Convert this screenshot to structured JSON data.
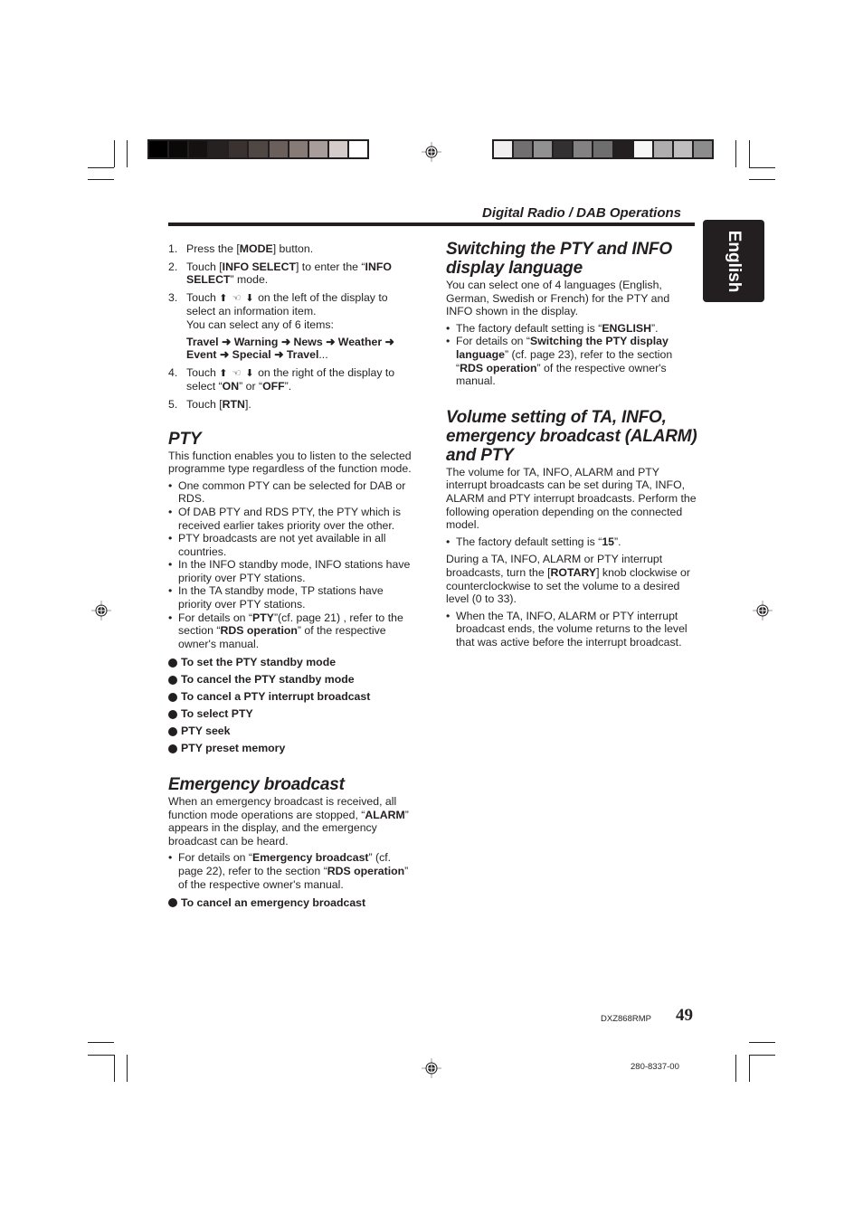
{
  "header": {
    "section_title": "Digital Radio / DAB Operations",
    "language_tab": "English"
  },
  "print_marks": {
    "left_color_bar": [
      "#000000",
      "#0b0908",
      "#151110",
      "#252120",
      "#3a3230",
      "#4f4744",
      "#6b5f5c",
      "#877b78",
      "#a89d9b",
      "#d4cccb",
      "#ffffff"
    ],
    "right_color_bar": [
      "#f0f0f0",
      "#707070",
      "#919191",
      "#323031",
      "#828282",
      "#6e6e6e",
      "#231f20",
      "#f7f7f7",
      "#aeaeae",
      "#bfbfbf",
      "#8c8c8c"
    ],
    "registration_icon": "crosshair-target-icon"
  },
  "left_column": {
    "steps": [
      {
        "num": "1.",
        "segments": [
          {
            "t": "Press the ["
          },
          {
            "t": "MODE",
            "b": true
          },
          {
            "t": "] button."
          }
        ]
      },
      {
        "num": "2.",
        "segments": [
          {
            "t": "Touch ["
          },
          {
            "t": "INFO SELECT",
            "b": true
          },
          {
            "t": "] to enter the “"
          },
          {
            "t": "INFO SELECT",
            "b": true
          },
          {
            "t": "” mode."
          }
        ]
      },
      {
        "num": "3.",
        "segments": [
          {
            "t": "Touch "
          },
          {
            "t": "⬆ ☜ ⬇",
            "g": true
          },
          {
            "t": " on the left of the display to select an information item."
          }
        ],
        "note": "You can select any of 6 items:",
        "sequence": [
          {
            "t": "Travel ➜ Warning ➜ News ➜ Weather ➜ Event ➜ Special ➜ Travel",
            "b": true
          },
          {
            "t": "..."
          }
        ]
      },
      {
        "num": "4.",
        "segments": [
          {
            "t": "Touch "
          },
          {
            "t": "⬆ ☜ ⬇",
            "g": true
          },
          {
            "t": " on the right of the display to select “"
          },
          {
            "t": "ON",
            "b": true
          },
          {
            "t": "” or “"
          },
          {
            "t": "OFF",
            "b": true
          },
          {
            "t": "”."
          }
        ]
      },
      {
        "num": "5.",
        "segments": [
          {
            "t": "Touch ["
          },
          {
            "t": "RTN",
            "b": true
          },
          {
            "t": "]."
          }
        ]
      }
    ],
    "pty": {
      "heading": "PTY",
      "intro": "This function enables you to listen to the selected programme type regardless of the function mode.",
      "bullets": [
        [
          {
            "t": "One common PTY can be selected for DAB or RDS."
          }
        ],
        [
          {
            "t": "Of DAB PTY and RDS PTY, the PTY which is received earlier takes priority over the other."
          }
        ],
        [
          {
            "t": "PTY broadcasts are not yet available in all countries."
          }
        ],
        [
          {
            "t": "In the INFO standby mode, INFO stations have priority over PTY stations."
          }
        ],
        [
          {
            "t": "In the TA standby mode, TP stations have priority over PTY stations."
          }
        ],
        [
          {
            "t": "For details on “"
          },
          {
            "t": "PTY",
            "b": true
          },
          {
            "t": "”(cf. page 21) , refer to the section “"
          },
          {
            "t": "RDS operation",
            "b": true
          },
          {
            "t": "” of the respective owner's manual."
          }
        ]
      ],
      "procedures": [
        "To set the PTY standby mode",
        "To cancel the PTY standby mode",
        "To cancel a PTY interrupt broadcast",
        "To select PTY",
        "PTY seek",
        "PTY preset memory"
      ]
    },
    "emergency": {
      "heading": "Emergency broadcast",
      "intro": [
        {
          "t": "When an emergency broadcast is received, all function mode operations are stopped, “"
        },
        {
          "t": "ALARM",
          "b": true
        },
        {
          "t": "” appears in the display, and the emergency broadcast can be heard."
        }
      ],
      "bullets": [
        [
          {
            "t": "For details on “"
          },
          {
            "t": "Emergency broadcast",
            "b": true
          },
          {
            "t": "” (cf. page 22), refer to the section “"
          },
          {
            "t": "RDS operation",
            "b": true
          },
          {
            "t": "” of the respective owner's manual."
          }
        ]
      ],
      "procedures": [
        "To cancel an emergency broadcast"
      ]
    }
  },
  "right_column": {
    "language": {
      "heading": "Switching the PTY and INFO display language",
      "intro": "You can select one of 4 languages (English, German, Swedish or French) for the PTY and INFO shown in the display.",
      "bullets": [
        [
          {
            "t": "The factory default setting is “"
          },
          {
            "t": "ENGLISH",
            "b": true
          },
          {
            "t": "”."
          }
        ],
        [
          {
            "t": "For details on “"
          },
          {
            "t": "Switching the PTY display language",
            "b": true
          },
          {
            "t": "” (cf. page 23), refer to the section “"
          },
          {
            "t": "RDS operation",
            "b": true
          },
          {
            "t": "” of the respective owner's manual."
          }
        ]
      ]
    },
    "volume": {
      "heading": "Volume setting of TA, INFO, emergency broadcast (ALARM) and PTY",
      "intro": "The volume for TA, INFO, ALARM and PTY interrupt broadcasts can be set during TA, INFO, ALARM and PTY interrupt broadcasts. Perform the following operation depending on the connected model.",
      "bullets1": [
        [
          {
            "t": "The factory default setting is “"
          },
          {
            "t": "15",
            "b": true
          },
          {
            "t": "”."
          }
        ]
      ],
      "para2": [
        {
          "t": "During a TA, INFO, ALARM or PTY interrupt broadcasts, turn the ["
        },
        {
          "t": "ROTARY",
          "b": true
        },
        {
          "t": "] knob clockwise or counterclockwise to set the volume to a desired level (0 to 33)."
        }
      ],
      "bullets2": [
        [
          {
            "t": "When the TA, INFO, ALARM or PTY interrupt broadcast ends, the volume returns to the level that was active before the interrupt broadcast."
          }
        ]
      ]
    }
  },
  "footer": {
    "model": "DXZ868RMP",
    "page_number": "49",
    "part_number": "280-8337-00"
  }
}
